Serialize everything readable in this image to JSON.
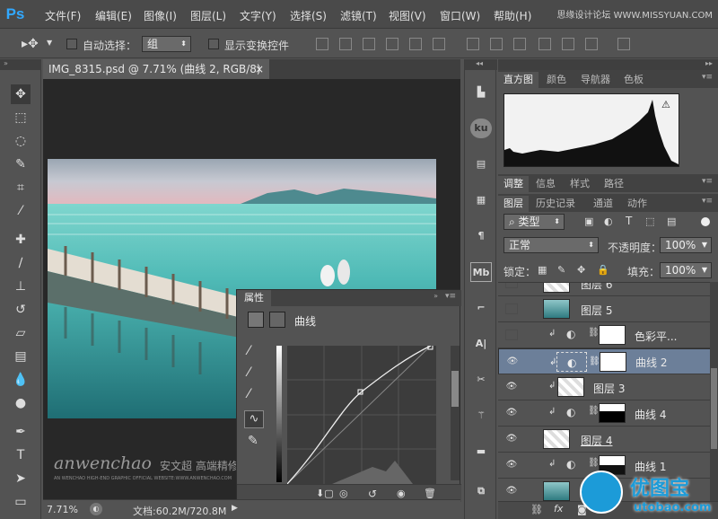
{
  "app": {
    "logo": "Ps",
    "watermark": "思缘设计论坛 WWW.MISSYUAN.COM"
  },
  "menu": [
    "文件(F)",
    "编辑(E)",
    "图像(I)",
    "图层(L)",
    "文字(Y)",
    "选择(S)",
    "滤镜(T)",
    "视图(V)",
    "窗口(W)",
    "帮助(H)"
  ],
  "options": {
    "auto_select_label": "自动选择：",
    "auto_select_value": "组",
    "show_transform_label": "显示变换控件"
  },
  "document": {
    "tab_title": "IMG_8315.psd @ 7.71% (曲线 2, RGB/8) *",
    "close": "×"
  },
  "status": {
    "zoom": "7.71%",
    "doc_size": "文档:60.2M/720.8M"
  },
  "photo_watermark": {
    "brand": "anwenchao",
    "cn": "安文超 高端精修",
    "small": "AN WENCHAO HIGH-END GRAPHIC OFFICIAL WEBSITE:WWW.ANWENCHAO.COM"
  },
  "properties": {
    "tab": "属性",
    "panel_title": "曲线"
  },
  "top_panel_tabs": [
    "直方图",
    "颜色",
    "导航器",
    "色板"
  ],
  "info_tabs": [
    "调整",
    "信息",
    "样式",
    "路径"
  ],
  "layer_tabs": [
    "图层",
    "历史记录",
    "通道",
    "动作"
  ],
  "layers_controls": {
    "filter_kind": "类型",
    "blend_mode": "正常",
    "opacity_label": "不透明度：",
    "opacity_value": "100%",
    "lock_label": "锁定：",
    "fill_label": "填充：",
    "fill_value": "100%"
  },
  "layers": [
    {
      "name": "图层 6",
      "visible": false,
      "clipped": false,
      "type": "pixel"
    },
    {
      "name": "图层 5",
      "visible": false,
      "clipped": false,
      "type": "pixel"
    },
    {
      "name": "色彩平...",
      "visible": false,
      "clipped": true,
      "type": "adjustment"
    },
    {
      "name": "曲线 2",
      "visible": true,
      "clipped": true,
      "type": "adjustment",
      "selected": true
    },
    {
      "name": "图层 3",
      "visible": true,
      "clipped": true,
      "type": "pixel"
    },
    {
      "name": "曲线 4",
      "visible": true,
      "clipped": true,
      "type": "adjustment"
    },
    {
      "name": "图层 4",
      "visible": true,
      "clipped": false,
      "type": "pixel"
    },
    {
      "name": "曲线 1",
      "visible": true,
      "clipped": true,
      "type": "adjustment"
    },
    {
      "name": "",
      "visible": true,
      "clipped": false,
      "type": "pixel"
    }
  ],
  "bottom_watermark": {
    "cn": "优图宝",
    "url": "utobao.com"
  },
  "colors": {
    "selected_layer": "#6c7f99",
    "panel_bg": "#535353",
    "canvas_bg": "#282828"
  }
}
